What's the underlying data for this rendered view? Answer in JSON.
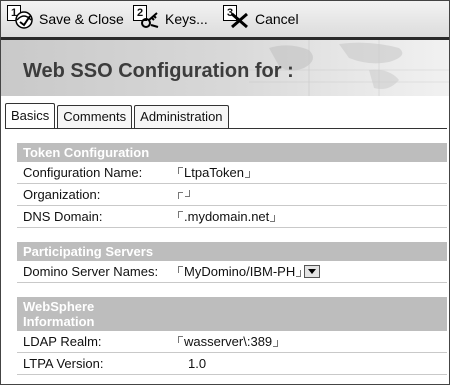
{
  "toolbar": {
    "buttons": [
      {
        "num": "1",
        "label": "Save & Close",
        "icon": "save-close-icon"
      },
      {
        "num": "2",
        "label": "Keys...",
        "icon": "keys-icon"
      },
      {
        "num": "3",
        "label": "Cancel",
        "icon": "cancel-icon"
      }
    ]
  },
  "banner": {
    "title": "Web SSO Configuration for :"
  },
  "tabs": [
    {
      "label": "Basics",
      "active": true
    },
    {
      "label": "Comments",
      "active": false
    },
    {
      "label": "Administration",
      "active": false
    }
  ],
  "sections": {
    "token": {
      "heading": "Token Configuration",
      "rows": [
        {
          "label": "Configuration Name:",
          "value": "LtpaToken"
        },
        {
          "label": "Organization:",
          "value": ""
        },
        {
          "label": "DNS Domain:",
          "value": ".mydomain.net"
        }
      ]
    },
    "servers": {
      "heading": "Participating Servers",
      "rows": [
        {
          "label": "Domino Server Names:",
          "value": "MyDomino/IBM-PH"
        }
      ]
    },
    "websphere": {
      "heading_line1": "WebSphere",
      "heading_line2": "Information",
      "rows": [
        {
          "label": "LDAP Realm:",
          "value": "wasserver\\:389"
        },
        {
          "label": "LTPA Version:",
          "value": "1.0"
        }
      ]
    }
  },
  "colors": {
    "section_header": "#bdbdbd",
    "toolbar_rule": "#2a2a2a"
  }
}
